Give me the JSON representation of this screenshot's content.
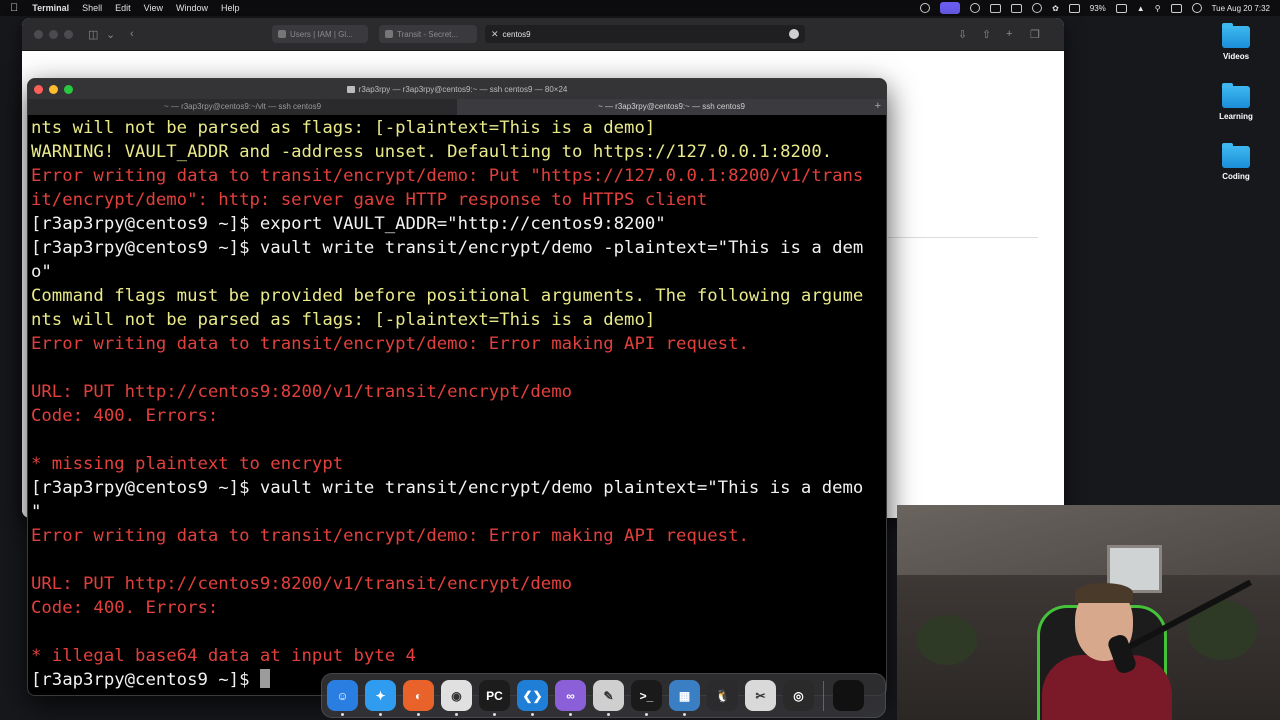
{
  "menubar": {
    "apple": "",
    "app_name": "Terminal",
    "menus": [
      "Shell",
      "Edit",
      "View",
      "Window",
      "Help"
    ],
    "battery": "93%",
    "clock": "Tue Aug 20  7:32"
  },
  "desktop": {
    "icons": [
      {
        "label": "Videos"
      },
      {
        "label": "Learning"
      },
      {
        "label": "Coding"
      }
    ]
  },
  "safari": {
    "tabs": [
      {
        "label": "Users | IAM | Gl..."
      },
      {
        "label": "Transit - Secret..."
      },
      {
        "label": "centos9"
      }
    ]
  },
  "terminal": {
    "title": "r3ap3rpy — r3ap3rpy@centos9:~ — ssh centos9 — 80×24",
    "tabs": [
      {
        "label": "~ — r3ap3rpy@centos9:~/vlt — ssh centos9"
      },
      {
        "label": "~ — r3ap3rpy@centos9:~ — ssh centos9"
      }
    ],
    "lines": [
      {
        "text": "nts will not be parsed as flags: [-plaintext=This is a demo]",
        "color": "yellow"
      },
      {
        "text": "WARNING! VAULT_ADDR and -address unset. Defaulting to https://127.0.0.1:8200.",
        "color": "yellow"
      },
      {
        "text": "Error writing data to transit/encrypt/demo: Put \"https://127.0.0.1:8200/v1/trans",
        "color": "red"
      },
      {
        "text": "it/encrypt/demo\": http: server gave HTTP response to HTTPS client",
        "color": "red"
      },
      {
        "text": "[r3ap3rpy@centos9 ~]$ export VAULT_ADDR=\"http://centos9:8200\"",
        "color": "white"
      },
      {
        "text": "[r3ap3rpy@centos9 ~]$ vault write transit/encrypt/demo -plaintext=\"This is a dem",
        "color": "white"
      },
      {
        "text": "o\"",
        "color": "white"
      },
      {
        "text": "Command flags must be provided before positional arguments. The following argume",
        "color": "yellow"
      },
      {
        "text": "nts will not be parsed as flags: [-plaintext=This is a demo]",
        "color": "yellow"
      },
      {
        "text": "Error writing data to transit/encrypt/demo: Error making API request.",
        "color": "red"
      },
      {
        "text": "",
        "color": "red"
      },
      {
        "text": "URL: PUT http://centos9:8200/v1/transit/encrypt/demo",
        "color": "red"
      },
      {
        "text": "Code: 400. Errors:",
        "color": "red"
      },
      {
        "text": "",
        "color": "red"
      },
      {
        "text": "* missing plaintext to encrypt",
        "color": "red"
      },
      {
        "text": "[r3ap3rpy@centos9 ~]$ vault write transit/encrypt/demo plaintext=\"This is a demo",
        "color": "white"
      },
      {
        "text": "\"",
        "color": "white"
      },
      {
        "text": "Error writing data to transit/encrypt/demo: Error making API request.",
        "color": "red"
      },
      {
        "text": "",
        "color": "red"
      },
      {
        "text": "URL: PUT http://centos9:8200/v1/transit/encrypt/demo",
        "color": "red"
      },
      {
        "text": "Code: 400. Errors:",
        "color": "red"
      },
      {
        "text": "",
        "color": "red"
      },
      {
        "text": "* illegal base64 data at input byte 4",
        "color": "red"
      }
    ],
    "prompt": "[r3ap3rpy@centos9 ~]$ "
  },
  "dock": {
    "apps": [
      {
        "name": "finder-app-icon",
        "glyph": "☺",
        "bg": "#2a7de1"
      },
      {
        "name": "safari-app-icon",
        "glyph": "✦",
        "bg": "#2f9cf0"
      },
      {
        "name": "firefox-app-icon",
        "glyph": "◐",
        "bg": "#e8622a"
      },
      {
        "name": "chrome-app-icon",
        "glyph": "◉",
        "bg": "#e0e0e0"
      },
      {
        "name": "pycharm-app-icon",
        "glyph": "PC",
        "bg": "#1c1c1c"
      },
      {
        "name": "vscode-app-icon",
        "glyph": "❮❯",
        "bg": "#1f7fd6"
      },
      {
        "name": "visual-studio-app-icon",
        "glyph": "∞",
        "bg": "#8b5fd8"
      },
      {
        "name": "preview-app-icon",
        "glyph": "✎",
        "bg": "#cfcfcf"
      },
      {
        "name": "terminal-app-icon",
        "glyph": ">_",
        "bg": "#1a1a1a"
      },
      {
        "name": "windows-app-icon",
        "glyph": "▦",
        "bg": "#3a7fc4"
      },
      {
        "name": "linux-app-icon",
        "glyph": "🐧",
        "bg": "#2b2b2e"
      },
      {
        "name": "final-cut-app-icon",
        "glyph": "✂",
        "bg": "#d9d9d9"
      },
      {
        "name": "obs-app-icon",
        "glyph": "◎",
        "bg": "#2a2a2a"
      },
      {
        "name": "minimized-window-icon",
        "glyph": "",
        "bg": "#111111"
      }
    ]
  }
}
